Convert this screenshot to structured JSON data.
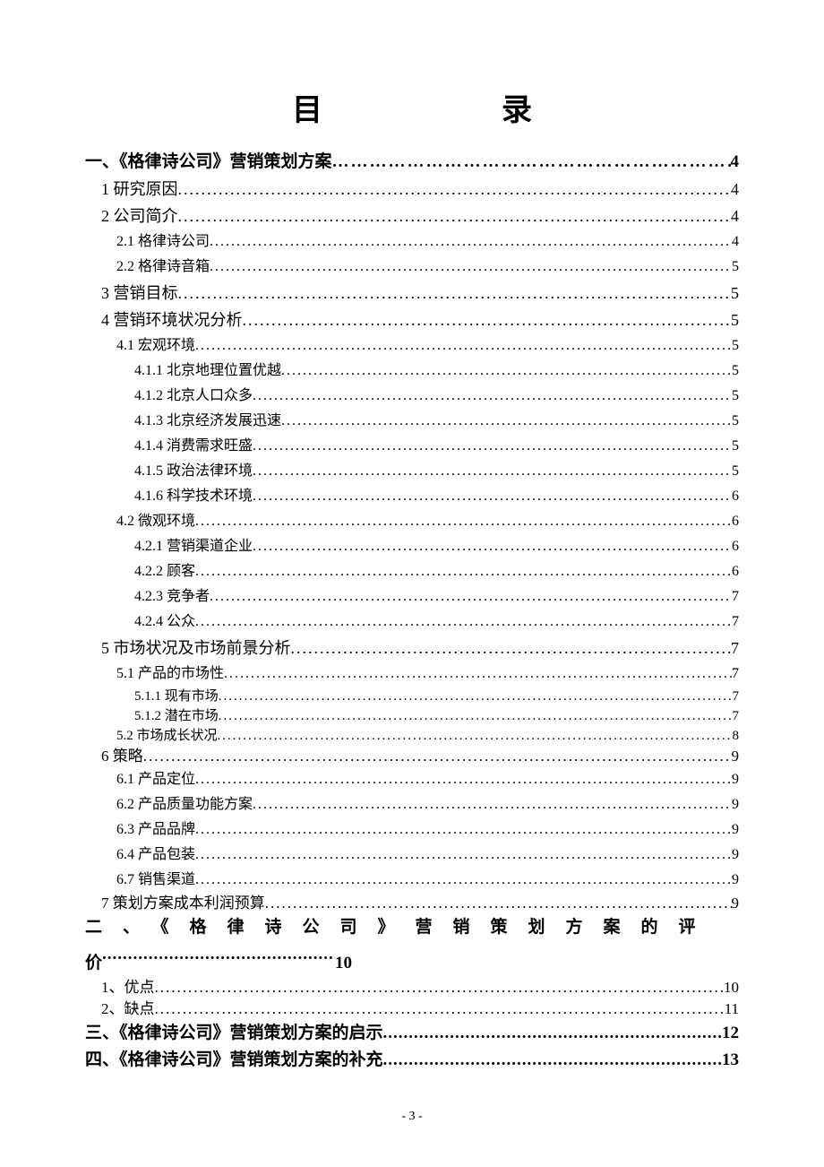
{
  "title_left": "目",
  "title_right": "录",
  "toc": [
    {
      "cls": "l0",
      "label": "一、《格律诗公司》营销策划方案",
      "page": "4"
    },
    {
      "cls": "l1",
      "label": "1 研究原因",
      "page": "4"
    },
    {
      "cls": "l1",
      "label": "2 公司简介",
      "page": "4"
    },
    {
      "cls": "l2",
      "label": "2.1 格律诗公司",
      "page": "4"
    },
    {
      "cls": "l2",
      "label": "2.2 格律诗音箱",
      "page": "5"
    },
    {
      "cls": "l1",
      "label": "3 营销目标",
      "page": "5"
    },
    {
      "cls": "l1",
      "label": "4 营销环境状况分析",
      "page": "5"
    },
    {
      "cls": "l2",
      "label": "4.1 宏观环境",
      "page": "5"
    },
    {
      "cls": "l3",
      "label": "4.1.1 北京地理位置优越",
      "page": "5"
    },
    {
      "cls": "l3",
      "label": "4.1.2 北京人口众多",
      "page": "5"
    },
    {
      "cls": "l3",
      "label": "4.1.3 北京经济发展迅速",
      "page": "5"
    },
    {
      "cls": "l3",
      "label": "4.1.4 消费需求旺盛",
      "page": "5"
    },
    {
      "cls": "l3",
      "label": "4.1.5 政治法律环境",
      "page": "5"
    },
    {
      "cls": "l3",
      "label": "4.1.6 科学技术环境",
      "page": "6"
    },
    {
      "cls": "l2",
      "label": "4.2 微观环境",
      "page": "6"
    },
    {
      "cls": "l3",
      "label": "4.2.1 营销渠道企业",
      "page": "6"
    },
    {
      "cls": "l3",
      "label": "4.2.2 顾客",
      "page": "6"
    },
    {
      "cls": "l3",
      "label": "4.2.3 竞争者",
      "page": "7"
    },
    {
      "cls": "l3",
      "label": "4.2.4 公众",
      "page": "7"
    },
    {
      "cls": "l1",
      "label": "5 市场状况及市场前景分析",
      "page": "7"
    },
    {
      "cls": "l2",
      "label": "5.1 产品的市场性",
      "page": "7"
    },
    {
      "cls": "l3t",
      "label": "5.1.1 现有市场",
      "page": "7"
    },
    {
      "cls": "l3t",
      "label": "5.1.2 潜在市场",
      "page": "7"
    },
    {
      "cls": "l2t",
      "label": "5.2 市场成长状况",
      "page": "8"
    },
    {
      "cls": "l1t",
      "label": "6 策略",
      "page": "9"
    },
    {
      "cls": "l2",
      "label": "6.1 产品定位",
      "page": "9"
    },
    {
      "cls": "l2",
      "label": "6.2 产品质量功能方案",
      "page": "9"
    },
    {
      "cls": "l2",
      "label": "6.3 产品品牌",
      "page": "9"
    },
    {
      "cls": "l2",
      "label": "6.4 产品包装",
      "page": "9"
    },
    {
      "cls": "l2",
      "label": "6.7 销售渠道",
      "page": "9"
    },
    {
      "cls": "l1t",
      "label": "7 策划方案成本利润预算",
      "page": "9"
    }
  ],
  "sec2_head": "二、《格律诗公司》营销策划方案的评",
  "sec2_tail_label": "价",
  "sec2_tail_page": "10",
  "toc2": [
    {
      "cls": "l1t",
      "label": "1、优点",
      "page": "10"
    },
    {
      "cls": "l1t",
      "label": "2、缺点",
      "page": "11"
    },
    {
      "cls": "l0b",
      "label": "三、《格律诗公司》营销策划方案的启示",
      "page": "12"
    },
    {
      "cls": "l0b",
      "label": "四、《格律诗公司》营销策划方案的补充",
      "page": "13"
    }
  ],
  "page_number": "- 3 -"
}
